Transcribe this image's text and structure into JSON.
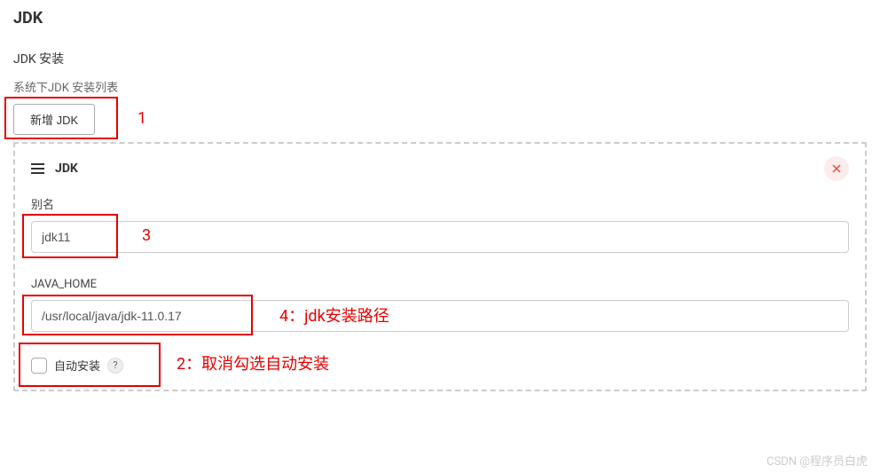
{
  "page": {
    "title": "JDK",
    "section_heading": "JDK 安装",
    "list_label": "系统下JDK 安装列表",
    "add_button_label": "新增 JDK"
  },
  "panel": {
    "title": "JDK",
    "alias_label": "别名",
    "alias_value": "jdk11",
    "java_home_label": "JAVA_HOME",
    "java_home_value": "/usr/local/java/jdk-11.0.17",
    "auto_install_label": "自动安装",
    "auto_install_checked": false
  },
  "annotations": {
    "n1": "1",
    "n2": "2：取消勾选自动安装",
    "n3": "3",
    "n4": "4：jdk安装路径"
  },
  "watermark": "CSDN @程序员白虎"
}
